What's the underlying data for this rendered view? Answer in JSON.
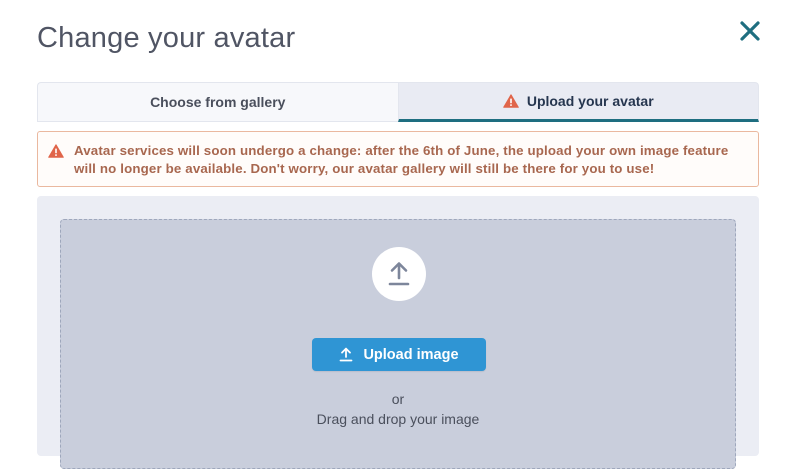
{
  "dialog": {
    "title": "Change your avatar",
    "close_icon": "close-icon"
  },
  "tabs": [
    {
      "label": "Choose from gallery",
      "active": false
    },
    {
      "label": "Upload your avatar",
      "active": true,
      "icon": "warning-icon"
    }
  ],
  "warning": {
    "icon": "warning-icon",
    "line1": "Avatar services will soon undergo a change: after the 6th of June, the upload your own image feature",
    "line2": "will no longer be available. Don't worry, our avatar gallery will still be there for you to use!"
  },
  "upload": {
    "icon": "upload-icon",
    "button_label": "Upload image",
    "or_text": "or",
    "drag_text": "Drag and drop your image"
  },
  "colors": {
    "accent": "#2f95d4",
    "close": "#1e6e80",
    "warning": "#e0654a",
    "warning_text": "#a8674f",
    "tab_underline": "#1e6e80",
    "dropzone": "#c9cedc"
  }
}
